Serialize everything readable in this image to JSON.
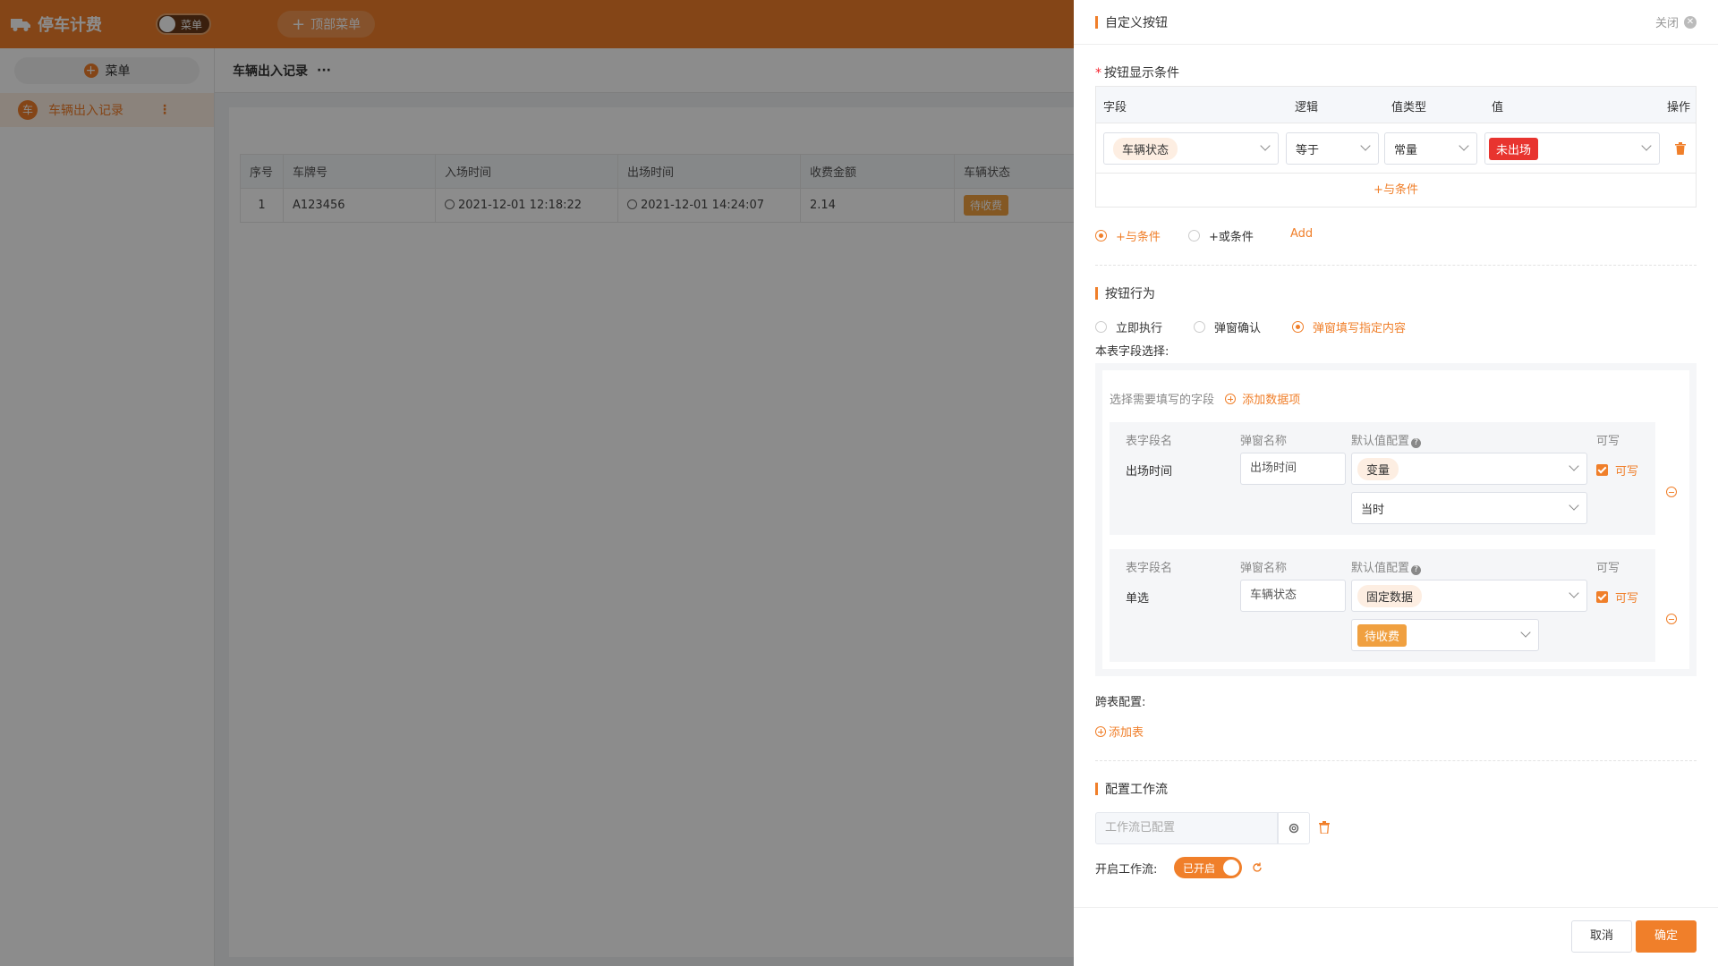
{
  "app": {
    "brand": "停车计费",
    "menu_switch_label": "菜单",
    "top_menu_label": "顶部菜单"
  },
  "sidebar": {
    "menu_button_label": "菜单",
    "items": [
      {
        "badge": "车",
        "label": "车辆出入记录"
      }
    ]
  },
  "page": {
    "title": "车辆出入记录"
  },
  "table": {
    "headers": [
      "序号",
      "车牌号",
      "入场时间",
      "出场时间",
      "收费金额",
      "车辆状态"
    ],
    "rows": [
      {
        "index": "1",
        "plate": "A123456",
        "entry_time": "2021-12-01 12:18:22",
        "exit_time": "2021-12-01 14:24:07",
        "amount": "2.14",
        "status": "待收费"
      }
    ]
  },
  "drawer": {
    "title": "自定义按钮",
    "close_label": "关闭",
    "display_condition": {
      "title": "按钮显示条件",
      "headers": {
        "field": "字段",
        "logic": "逻辑",
        "value_type": "值类型",
        "value": "值",
        "action": "操作"
      },
      "row": {
        "field": "车辆状态",
        "logic": "等于",
        "value_type": "常量",
        "value": "未出场"
      },
      "add_and_row": "+与条件",
      "radio_and": "+与条件",
      "radio_or": "+或条件",
      "add_link": "Add"
    },
    "behavior": {
      "title": "按钮行为",
      "options": [
        "立即执行",
        "弹窗确认",
        "弹窗填写指定内容"
      ],
      "selected": "弹窗填写指定内容",
      "this_table_label": "本表字段选择:",
      "select_prompt": "选择需要填写的字段",
      "add_item": "添加数据项",
      "col_headers": {
        "field_name": "表字段名",
        "popup_name": "弹窗名称",
        "default": "默认值配置",
        "writable": "可写"
      },
      "fields": [
        {
          "field_name": "出场时间",
          "popup_name": "出场时间",
          "default_type": "变量",
          "default_value": "当时",
          "writable": "可写"
        },
        {
          "field_name": "单选",
          "popup_name": "车辆状态",
          "default_type": "固定数据",
          "default_value": "待收费",
          "writable": "可写"
        }
      ],
      "cross_table_label": "跨表配置:",
      "add_table": "添加表"
    },
    "workflow": {
      "title": "配置工作流",
      "input_placeholder": "工作流已配置",
      "enable_label": "开启工作流:",
      "toggle_label": "已开启"
    },
    "footer": {
      "cancel": "取消",
      "confirm": "确定"
    }
  },
  "colors": {
    "accent": "#f07f2a",
    "danger": "#e8342f",
    "status_pending": "#f0a040"
  }
}
